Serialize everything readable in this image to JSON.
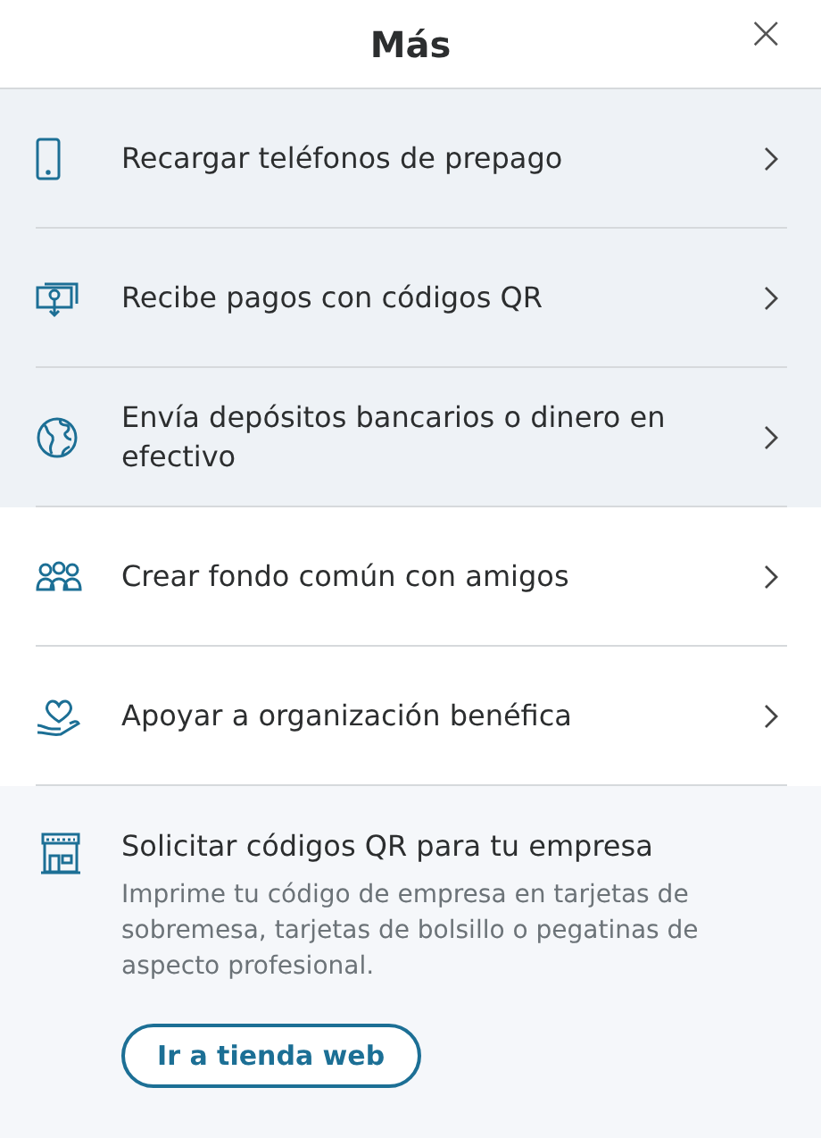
{
  "header": {
    "title": "Más",
    "close": "×"
  },
  "items": [
    {
      "label": "Recargar teléfonos de prepago",
      "shaded": true
    },
    {
      "label": "Recibe pagos con códigos QR",
      "shaded": true
    },
    {
      "label": "Envía depósitos bancarios o dinero en efectivo",
      "shaded": true
    },
    {
      "label": "Crear fondo común con amigos",
      "shaded": false
    },
    {
      "label": "Apoyar a organización benéfica",
      "shaded": false
    }
  ],
  "promo": {
    "title": "Solicitar códigos QR para tu empresa",
    "description": "Imprime tu código de empresa en tarjetas de sobremesa, tarjetas de bolsillo o pegatinas de aspecto profesional.",
    "button": "Ir a tienda web"
  }
}
